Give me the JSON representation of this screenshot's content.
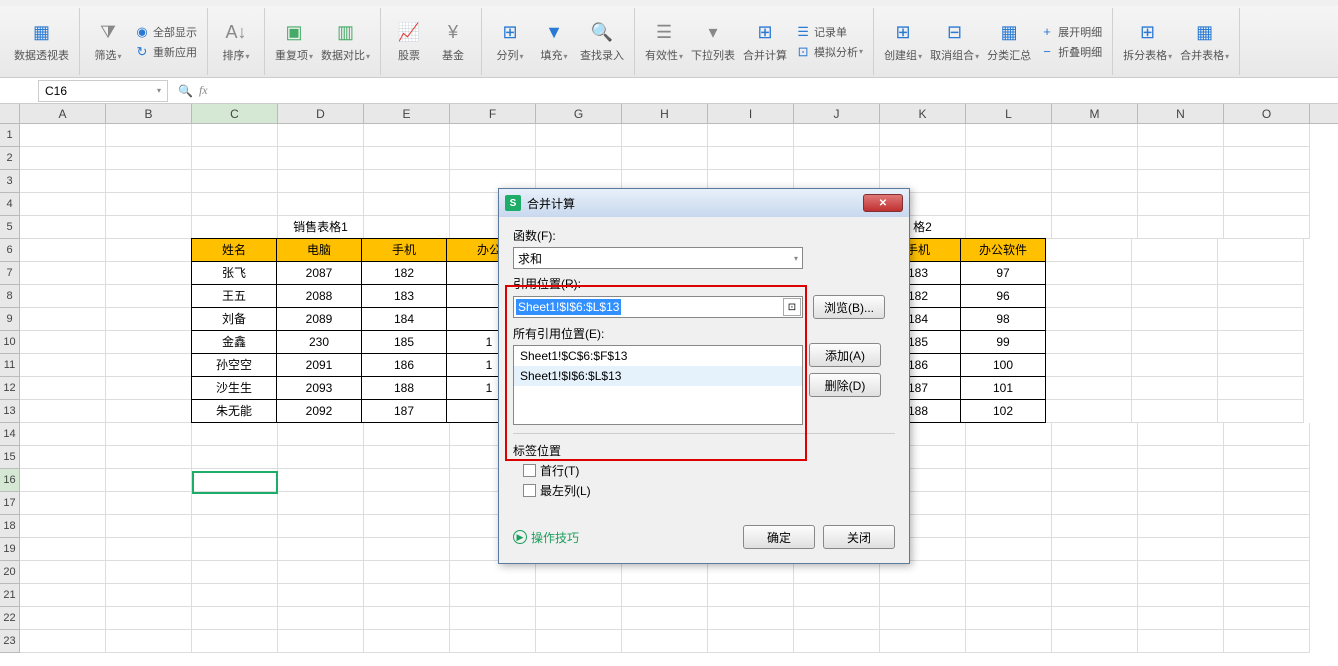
{
  "ribbon": {
    "pivot": "数据透视表",
    "filter": "筛选",
    "show_all": "全部显示",
    "reapply": "重新应用",
    "sort": "排序",
    "duplicates": "重复项",
    "compare": "数据对比",
    "stock": "股票",
    "fund": "基金",
    "text_to_cols": "分列",
    "fill": "填充",
    "find_record": "查找录入",
    "validation": "有效性",
    "dropdown": "下拉列表",
    "consolidate": "合并计算",
    "record_form": "记录单",
    "simulate": "模拟分析",
    "create_group": "创建组",
    "ungroup": "取消组合",
    "subtotal": "分类汇总",
    "expand_detail": "展开明细",
    "collapse_detail": "折叠明细",
    "split_table": "拆分表格",
    "merge_table": "合并表格"
  },
  "formula_bar": {
    "name_box": "C16"
  },
  "columns": [
    "A",
    "B",
    "C",
    "D",
    "E",
    "F",
    "G",
    "H",
    "I",
    "J",
    "K",
    "L",
    "M",
    "N",
    "O"
  ],
  "sheet": {
    "title1": "销售表格1",
    "title2_suffix": "格2",
    "headers_left": [
      "姓名",
      "电脑",
      "手机",
      "办公"
    ],
    "headers_right": [
      "手机",
      "办公软件"
    ],
    "data_left": [
      [
        "张飞",
        "2087",
        "182"
      ],
      [
        "王五",
        "2088",
        "183"
      ],
      [
        "刘备",
        "2089",
        "184"
      ],
      [
        "金鑫",
        "230",
        "185"
      ],
      [
        "孙空空",
        "2091",
        "186"
      ],
      [
        "沙生生",
        "2093",
        "188"
      ],
      [
        "朱无能",
        "2092",
        "187"
      ]
    ],
    "data_right": [
      [
        "183",
        "97"
      ],
      [
        "182",
        "96"
      ],
      [
        "184",
        "98"
      ],
      [
        "185",
        "99"
      ],
      [
        "186",
        "100"
      ],
      [
        "187",
        "101"
      ],
      [
        "188",
        "102"
      ]
    ]
  },
  "dialog": {
    "title": "合并计算",
    "function_label": "函数(F):",
    "function_value": "求和",
    "reference_label": "引用位置(R):",
    "reference_value": "Sheet1!$I$6:$L$13",
    "all_refs_label": "所有引用位置(E):",
    "ref_list": [
      "Sheet1!$C$6:$F$13",
      "Sheet1!$I$6:$L$13"
    ],
    "browse": "浏览(B)...",
    "add": "添加(A)",
    "delete": "删除(D)",
    "label_position": "标签位置",
    "top_row": "首行(T)",
    "left_col": "最左列(L)",
    "tips": "操作技巧",
    "ok": "确定",
    "close": "关闭"
  }
}
